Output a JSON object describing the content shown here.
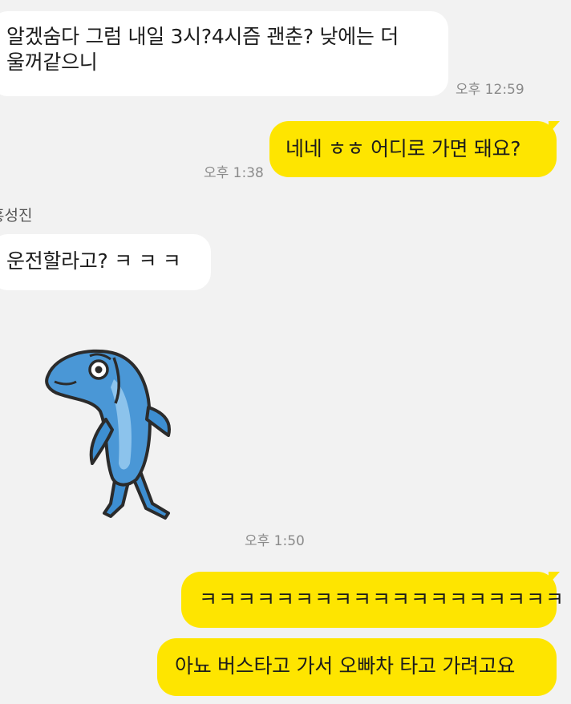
{
  "chat": {
    "messages": [
      {
        "side": "incoming",
        "text_line1": "알겠숨다 그럼 내일 3시?4시즘 괜춘? 낮에는 더",
        "text_line2": "울꺼같으니",
        "time": "오후 12:59"
      },
      {
        "side": "outgoing",
        "text": "네네 ㅎㅎ 어디로 가면 돼요?",
        "time": "오후 1:38"
      },
      {
        "side": "incoming",
        "sender": "홍성진",
        "text": "운전할라고? ㅋ ㅋ ㅋ"
      },
      {
        "side": "incoming",
        "type": "sticker",
        "sticker": "blue-fish-standing-sticker",
        "time": "오후 1:50"
      },
      {
        "side": "outgoing",
        "text": "ㅋㅋㅋㅋㅋㅋㅋㅋㅋㅋㅋㅋㅋㅋㅋㅋㅋㅋㅋ"
      },
      {
        "side": "outgoing",
        "text": "아뇨 버스타고 가서 오빠차 타고 가려고요"
      }
    ]
  },
  "colors": {
    "background": "#f2f2f2",
    "outgoing_bubble": "#fee500",
    "incoming_bubble": "#ffffff",
    "timestamp": "#8a8a8a"
  }
}
